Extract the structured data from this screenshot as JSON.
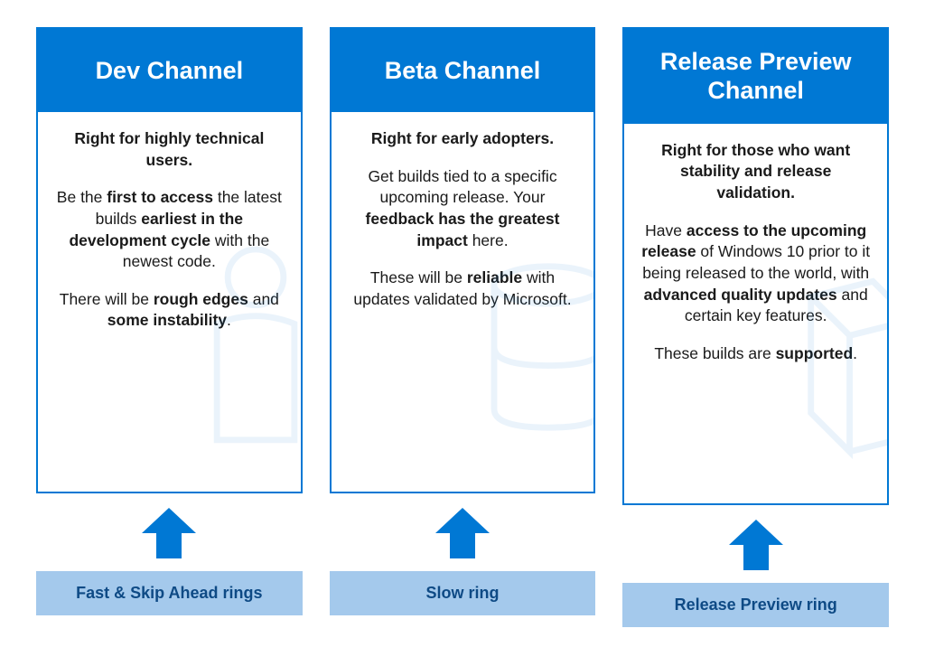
{
  "columns": [
    {
      "title": "Dev Channel",
      "tagline": "Right for highly technical users.",
      "p1_a": "Be the ",
      "p1_b1": "first to access",
      "p1_c": " the latest builds ",
      "p1_b2": "earliest in the development cycle",
      "p1_d": " with the newest code.",
      "p2_a": "There will be ",
      "p2_b1": "rough edges",
      "p2_c": " and ",
      "p2_b2": "some instability",
      "p2_d": ".",
      "ring": "Fast & Skip Ahead rings"
    },
    {
      "title": "Beta Channel",
      "tagline": "Right for early adopters.",
      "p1_a": "Get builds tied to a specific upcoming release. Your ",
      "p1_b1": "feedback has the greatest impact",
      "p1_c": " here.",
      "p1_b2": "",
      "p1_d": "",
      "p2_a": "These will be ",
      "p2_b1": "reliable",
      "p2_c": " with updates validated by Microsoft.",
      "p2_b2": "",
      "p2_d": "",
      "ring": "Slow ring"
    },
    {
      "title": "Release Preview Channel",
      "tagline": "Right for those who want stability and release validation.",
      "p1_a": "Have ",
      "p1_b1": "access to the upcoming release",
      "p1_c": " of Windows 10 prior to it being released to the world, with ",
      "p1_b2": "advanced quality updates",
      "p1_d": " and certain key features.",
      "p2_a": "These builds are ",
      "p2_b1": "supported",
      "p2_c": ".",
      "p2_b2": "",
      "p2_d": "",
      "ring": "Release Preview ring"
    }
  ],
  "colors": {
    "primary": "#0078d4",
    "ring_bg": "#a4c9ec",
    "ring_text": "#0e4a85"
  }
}
